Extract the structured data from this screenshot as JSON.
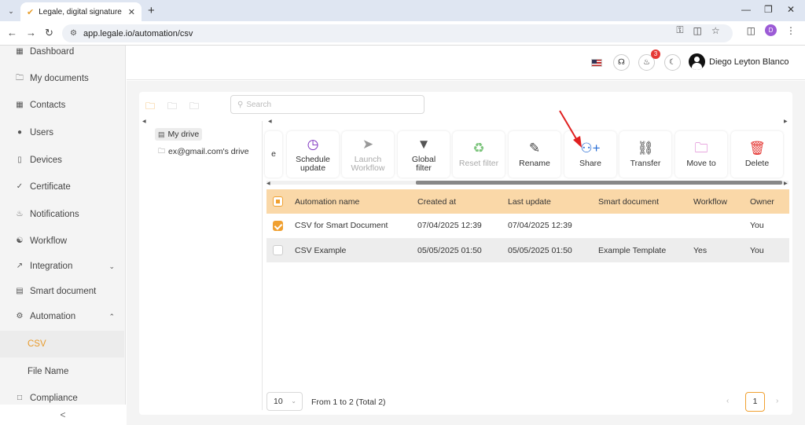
{
  "browser": {
    "tab_title": "Legale, digital signature",
    "url": "app.legale.io/automation/csv",
    "profile_initial": "D"
  },
  "sidebar": {
    "items": [
      {
        "label": "Dashboard",
        "icon": "dashboard-icon"
      },
      {
        "label": "My documents",
        "icon": "folder-icon"
      },
      {
        "label": "Contacts",
        "icon": "contacts-icon"
      },
      {
        "label": "Users",
        "icon": "user-icon"
      },
      {
        "label": "Devices",
        "icon": "device-icon"
      },
      {
        "label": "Certificate",
        "icon": "shield-icon"
      },
      {
        "label": "Notifications",
        "icon": "bell-icon"
      },
      {
        "label": "Workflow",
        "icon": "workflow-icon"
      },
      {
        "label": "Integration",
        "icon": "integration-icon"
      },
      {
        "label": "Smart document",
        "icon": "smart-document-icon"
      },
      {
        "label": "Automation",
        "icon": "automation-icon"
      }
    ],
    "sub_items": [
      {
        "label": "CSV",
        "active": true
      },
      {
        "label": "File Name",
        "active": false
      }
    ],
    "partial_item": "Compliance",
    "collapse_glyph": "<"
  },
  "header": {
    "notification_count": "3",
    "user_name": "Diego Leyton Blanco"
  },
  "search": {
    "placeholder": "Search"
  },
  "tree": {
    "root": "My drive",
    "child": "ex@gmail.com's drive"
  },
  "toolbar": {
    "partial_glyph": "e",
    "buttons": [
      {
        "label_1": "Schedule",
        "label_2": "update",
        "icon": "schedule-icon",
        "disabled": false
      },
      {
        "label_1": "Launch",
        "label_2": "Workflow",
        "icon": "rocket-icon",
        "disabled": true
      },
      {
        "label_1": "Global",
        "label_2": "filter",
        "icon": "filter-icon",
        "disabled": false
      },
      {
        "label_1": "Reset filter",
        "label_2": "",
        "icon": "recycle-icon",
        "disabled": true
      },
      {
        "label_1": "Rename",
        "label_2": "",
        "icon": "pen-icon",
        "disabled": false
      },
      {
        "label_1": "Share",
        "label_2": "",
        "icon": "user-plus-icon",
        "disabled": false
      },
      {
        "label_1": "Transfer",
        "label_2": "",
        "icon": "transfer-icon",
        "disabled": false
      },
      {
        "label_1": "Move to",
        "label_2": "",
        "icon": "folder-move-icon",
        "disabled": false
      },
      {
        "label_1": "Delete",
        "label_2": "",
        "icon": "trash-icon",
        "disabled": false
      }
    ]
  },
  "table": {
    "columns": [
      "Automation name",
      "Created at",
      "Last update",
      "Smart document",
      "Workflow",
      "Owner"
    ],
    "rows": [
      {
        "checked": true,
        "cells": [
          "CSV for Smart Document",
          "07/04/2025 12:39",
          "07/04/2025 12:39",
          "",
          "",
          "You"
        ]
      },
      {
        "checked": false,
        "cells": [
          "CSV Example",
          "05/05/2025 01:50",
          "05/05/2025 01:50",
          "Example Template",
          "Yes",
          "You"
        ]
      }
    ]
  },
  "pagination": {
    "page_size": "10",
    "summary": "From 1 to 2 (Total 2)",
    "current_page": "1"
  },
  "annotation": {
    "color": "#e02020"
  }
}
